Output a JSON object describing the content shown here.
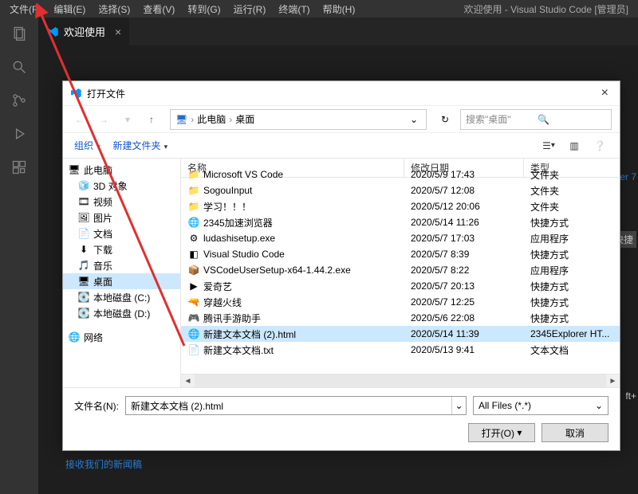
{
  "menubar": {
    "items": [
      "文件(F)",
      "编辑(E)",
      "选择(S)",
      "查看(V)",
      "转到(G)",
      "运行(R)",
      "终端(T)",
      "帮助(H)"
    ],
    "title": "欢迎使用 - Visual Studio Code [管理员]"
  },
  "tab": {
    "label": "欢迎使用"
  },
  "dialog": {
    "title": "打开文件",
    "breadcrumb": {
      "root": "此电脑",
      "child": "桌面"
    },
    "search_placeholder": "搜索\"桌面\"",
    "toolbar": {
      "organize": "组织",
      "newfolder": "新建文件夹"
    },
    "tree": [
      {
        "label": "此电脑",
        "icon": "monitor",
        "sel": false
      },
      {
        "label": "3D 对象",
        "icon": "cube",
        "sel": false,
        "indent": 1
      },
      {
        "label": "视频",
        "icon": "video",
        "sel": false,
        "indent": 1
      },
      {
        "label": "图片",
        "icon": "pic",
        "sel": false,
        "indent": 1
      },
      {
        "label": "文档",
        "icon": "doc",
        "sel": false,
        "indent": 1
      },
      {
        "label": "下载",
        "icon": "down",
        "sel": false,
        "indent": 1
      },
      {
        "label": "音乐",
        "icon": "music",
        "sel": false,
        "indent": 1
      },
      {
        "label": "桌面",
        "icon": "desktop",
        "sel": true,
        "indent": 1
      },
      {
        "label": "本地磁盘 (C:)",
        "icon": "disk",
        "sel": false,
        "indent": 1
      },
      {
        "label": "本地磁盘 (D:)",
        "icon": "disk",
        "sel": false,
        "indent": 1
      },
      {
        "label": "网络",
        "icon": "net",
        "sel": false,
        "indent": 0,
        "gap": true
      }
    ],
    "columns": {
      "name": "名称",
      "date": "修改日期",
      "type": "类型"
    },
    "files": [
      {
        "name": "Microsoft VS Code",
        "date": "2020/5/9 17:43",
        "type": "文件夹",
        "icon": "folder"
      },
      {
        "name": "SogouInput",
        "date": "2020/5/7 12:08",
        "type": "文件夹",
        "icon": "folder"
      },
      {
        "name": "学习！！！",
        "date": "2020/5/12 20:06",
        "type": "文件夹",
        "icon": "folder"
      },
      {
        "name": "2345加速浏览器",
        "date": "2020/5/14 11:26",
        "type": "快捷方式",
        "icon": "browser"
      },
      {
        "name": "ludashisetup.exe",
        "date": "2020/5/7 17:03",
        "type": "应用程序",
        "icon": "exe"
      },
      {
        "name": "Visual Studio Code",
        "date": "2020/5/7 8:39",
        "type": "快捷方式",
        "icon": "vscode"
      },
      {
        "name": "VSCodeUserSetup-x64-1.44.2.exe",
        "date": "2020/5/7 8:22",
        "type": "应用程序",
        "icon": "installer"
      },
      {
        "name": "爱奇艺",
        "date": "2020/5/7 20:13",
        "type": "快捷方式",
        "icon": "iqiyi"
      },
      {
        "name": "穿越火线",
        "date": "2020/5/7 12:25",
        "type": "快捷方式",
        "icon": "cf"
      },
      {
        "name": "腾讯手游助手",
        "date": "2020/5/6 22:08",
        "type": "快捷方式",
        "icon": "tencent"
      },
      {
        "name": "新建文本文档 (2).html",
        "date": "2020/5/14 11:39",
        "type": "2345Explorer HT...",
        "icon": "html",
        "sel": true
      },
      {
        "name": "新建文本文档.txt",
        "date": "2020/5/13 9:41",
        "type": "文本文档",
        "icon": "txt"
      }
    ],
    "filename_label": "文件名(N):",
    "filename_value": "新建文本文档 (2).html",
    "filter": "All Files (*.*)",
    "open_btn": "打开(O)",
    "cancel_btn": "取消"
  },
  "side": {
    "er": "er 7",
    "kj": "快捷",
    "ft": "ft+"
  },
  "footer": "接收我们的新闻稿"
}
